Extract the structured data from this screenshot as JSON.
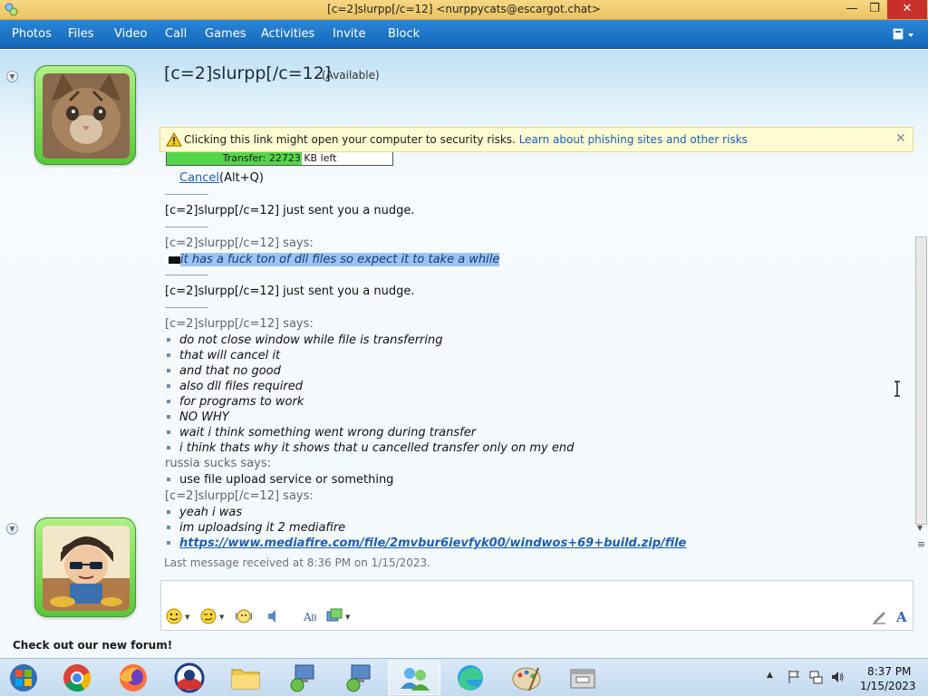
{
  "window": {
    "title": "[c=2]slurpp[/c=12] <nurppycats@escargot.chat>"
  },
  "menu": {
    "items": [
      "Photos",
      "Files",
      "Video",
      "Call",
      "Games",
      "Activities",
      "Invite",
      "Block"
    ]
  },
  "contact": {
    "name": "[c=2]slurpp[/c=12]",
    "status": "(Available)"
  },
  "warning": {
    "text": "Clicking this link might open your computer to security risks.",
    "link": "Learn about phishing sites and other risks"
  },
  "transfer": {
    "label": "Transfer: 22723 KB left",
    "progress": 0.6,
    "cancel_label": "Cancel",
    "cancel_shortcut": "(Alt+Q)"
  },
  "conversation": {
    "nudge1": "[c=2]slurpp[/c=12] just sent you a nudge.",
    "says1": "[c=2]slurpp[/c=12] says:",
    "msg1": "it has a fuck ton of dll files so expect it to take a while",
    "nudge2": "[c=2]slurpp[/c=12] just sent you a nudge.",
    "says2": "[c=2]slurpp[/c=12] says:",
    "block2": [
      "do not close window while file is transferring",
      "that will cancel it",
      "and that no good",
      "also dll files required",
      "for programs to work",
      "NO WHY",
      "wait i think something went wrong during transfer",
      "i think thats why it shows that u cancelled transfer only on my end"
    ],
    "says3": "russia sucks says:",
    "block3": [
      "use file upload service or something"
    ],
    "says4": "[c=2]slurpp[/c=12] says:",
    "block4": [
      "yeah i was",
      "im uploadsing it 2 mediafire"
    ],
    "link": "https://www.mediafire.com/file/2mvbur6ievfyk00/windwos+69+build.zip/file"
  },
  "last_message": "Last message received at 8:36 PM on 1/15/2023.",
  "ad_text": "Check out our new forum!",
  "clock": {
    "time": "8:37 PM",
    "date": "1/15/2023"
  },
  "colors": {
    "menu_bar": "#1a6fc0",
    "title_bar": "#eecb68",
    "avatar_frame": "#5fcf3d",
    "link": "#1d5fb3",
    "close_button": "#c9302c"
  }
}
